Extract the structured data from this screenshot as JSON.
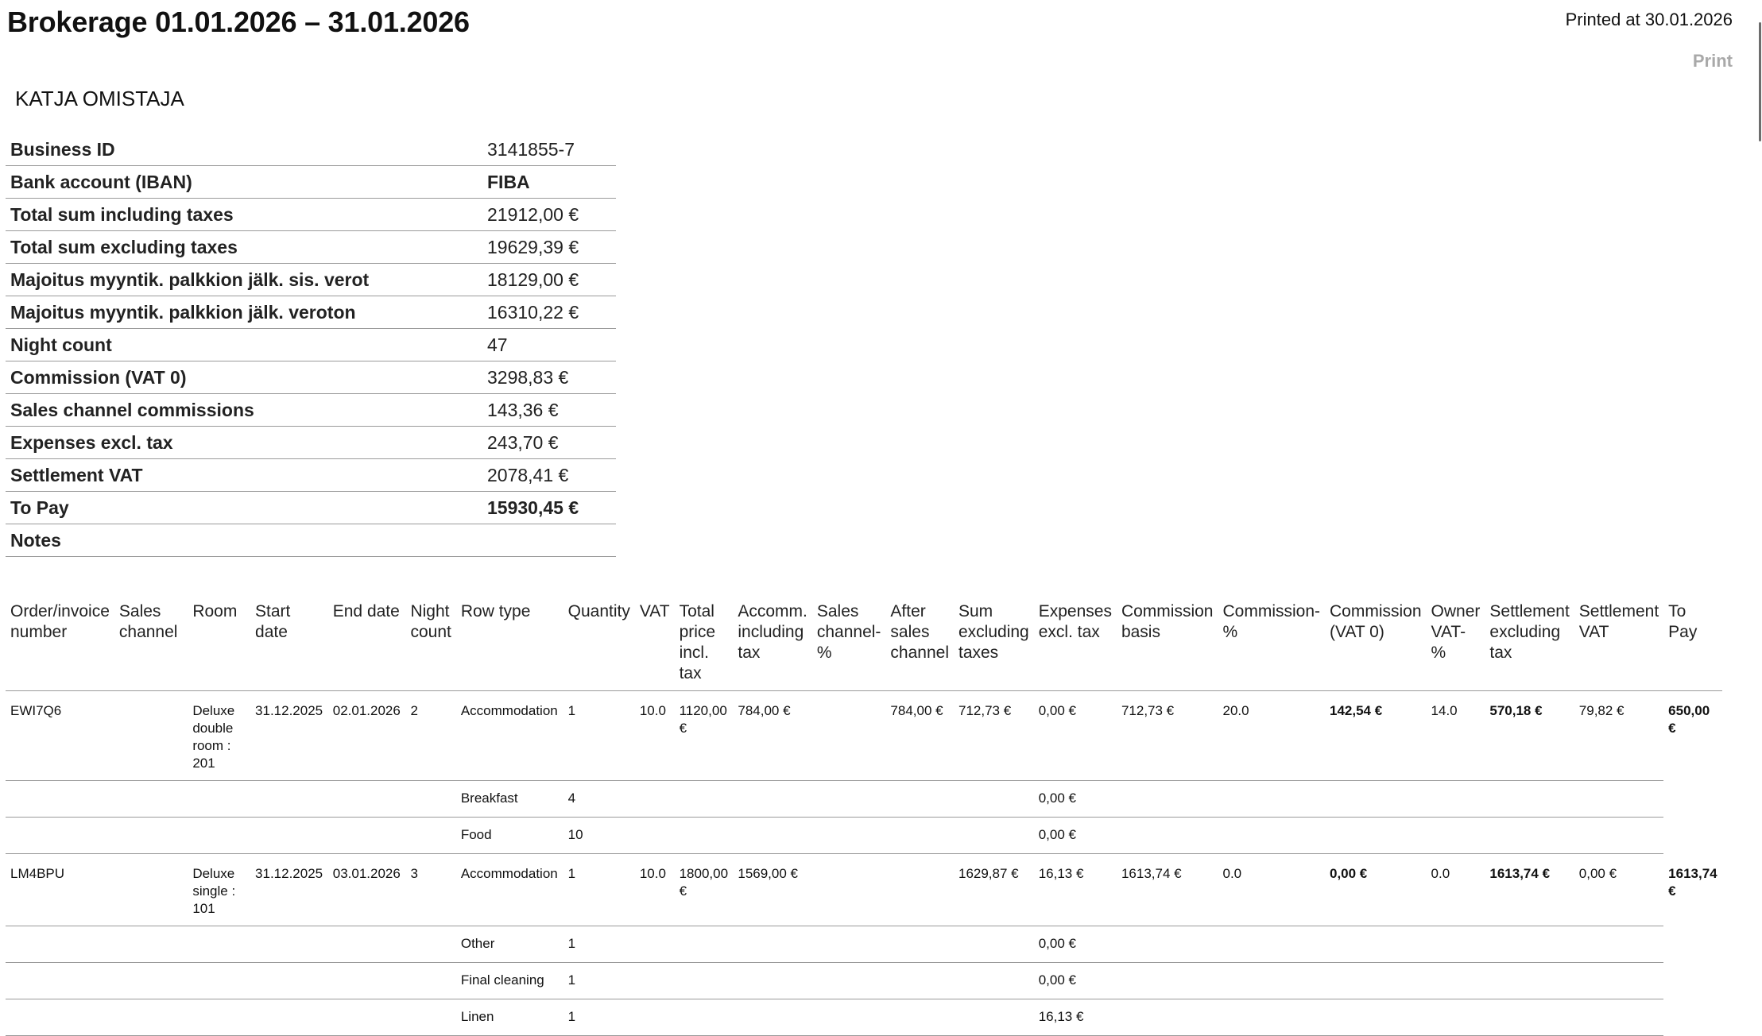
{
  "header": {
    "title": "Brokerage 01.01.2026 – 31.01.2026",
    "printed": "Printed at 30.01.2026",
    "print_label": "Print"
  },
  "owner_name": "KATJA OMISTAJA",
  "summary": [
    {
      "label": "Business ID",
      "value": "3141855-7"
    },
    {
      "label": "Bank account (IBAN)",
      "value": "FIBA"
    },
    {
      "label": "Total sum including taxes",
      "value": "21912,00 €"
    },
    {
      "label": "Total sum excluding taxes",
      "value": "19629,39 €"
    },
    {
      "label": "Majoitus myyntik. palkkion jälk. sis. verot",
      "value": "18129,00 €"
    },
    {
      "label": "Majoitus myyntik. palkkion jälk. veroton",
      "value": "16310,22 €"
    },
    {
      "label": "Night count",
      "value": "47"
    },
    {
      "label": "Commission (VAT 0)",
      "value": "3298,83 €"
    },
    {
      "label": "Sales channel commissions",
      "value": "143,36 €"
    },
    {
      "label": "Expenses excl. tax",
      "value": "243,70 €"
    },
    {
      "label": "Settlement VAT",
      "value": "2078,41 €"
    },
    {
      "label": "To Pay",
      "value": "15930,45 €"
    },
    {
      "label": "Notes",
      "value": ""
    }
  ],
  "columns": [
    "Order/invoice number",
    "Sales channel",
    "Room",
    "Start date",
    "End date",
    "Night count",
    "Row type",
    "Quantity",
    "VAT",
    "Total price incl. tax",
    "Accomm. including tax",
    "Sales channel-%",
    "After sales channel",
    "Sum excluding taxes",
    "Expenses excl. tax",
    "Commission basis",
    "Commission-%",
    "Commission (VAT 0)",
    "Owner VAT-%",
    "Settlement excluding tax",
    "Settlement VAT",
    "To Pay"
  ],
  "orders": [
    {
      "main": [
        "EWI7Q6",
        "",
        "Deluxe double room : 201",
        "31.12.2025",
        "02.01.2026",
        "2",
        "Accommodation",
        "1",
        "10.0",
        "1120,00 €",
        "784,00 €",
        "",
        "784,00 €",
        "712,73 €",
        "0,00 €",
        "712,73 €",
        "20.0",
        "142,54 €",
        "14.0",
        "570,18 €",
        "79,82 €",
        "650,00 €"
      ],
      "subs": [
        {
          "type": "Breakfast",
          "qty": "4",
          "exp": "0,00 €"
        },
        {
          "type": "Food",
          "qty": "10",
          "exp": "0,00 €"
        }
      ]
    },
    {
      "main": [
        "LM4BPU",
        "",
        "Deluxe single : 101",
        "31.12.2025",
        "03.01.2026",
        "3",
        "Accommodation",
        "1",
        "10.0",
        "1800,00 €",
        "1569,00 €",
        "",
        "",
        "1629,87 €",
        "16,13 €",
        "1613,74 €",
        "0.0",
        "0,00 €",
        "0.0",
        "1613,74 €",
        "0,00 €",
        "1613,74 €"
      ],
      "subs": [
        {
          "type": "Other",
          "qty": "1",
          "exp": "0,00 €"
        },
        {
          "type": "Final cleaning",
          "qty": "1",
          "exp": "0,00 €"
        },
        {
          "type": "Linen",
          "qty": "1",
          "exp": "16,13 €"
        }
      ]
    }
  ]
}
